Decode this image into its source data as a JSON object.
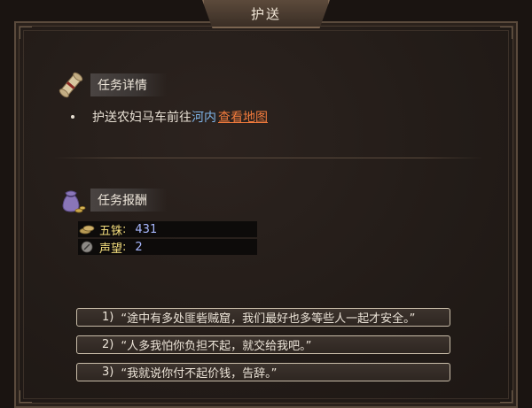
{
  "window": {
    "title": "护送"
  },
  "details": {
    "header": "任务详情",
    "text_prefix": "护送农妇马车前往",
    "place": "河内",
    "map_link": "查看地图"
  },
  "rewards": {
    "header": "任务报酬",
    "items": [
      {
        "name": "五铢",
        "value": "431",
        "icon": "coin-icon"
      },
      {
        "name": "声望",
        "value": "2",
        "icon": "reputation-icon"
      }
    ]
  },
  "options": [
    {
      "num": "1)",
      "text": "“途中有多处匪砦贼窟，我们最好也多等些人一起才安全。”"
    },
    {
      "num": "2)",
      "text": "“人多我怕你负担不起，就交给我吧。”"
    },
    {
      "num": "3)",
      "text": "“我就说你付不起价钱，告辞。”"
    }
  ],
  "colors": {
    "place_link": "#7fb4e8",
    "map_link": "#f07a3c",
    "reward_name": "#f2dc7c",
    "reward_value": "#a8b8ff"
  }
}
